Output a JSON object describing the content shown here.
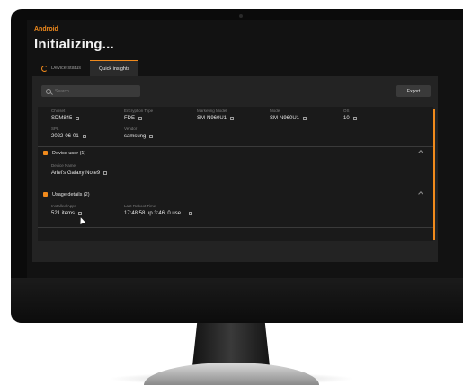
{
  "app": {
    "platform": "Android",
    "title": "Initializing..."
  },
  "tabs": [
    {
      "label": "Device status",
      "active": false
    },
    {
      "label": "Quick insights",
      "active": true
    }
  ],
  "toolbar": {
    "search_placeholder": "Search",
    "export_label": "Export"
  },
  "overview": {
    "fields": [
      {
        "label": "Chipset",
        "value": "SDM845"
      },
      {
        "label": "Encryption Type",
        "value": "FDE"
      },
      {
        "label": "Marketing Model",
        "value": "SM-N960U1"
      },
      {
        "label": "Model",
        "value": "SM-N960U1"
      },
      {
        "label": "OS",
        "value": "10"
      },
      {
        "label": "SPL",
        "value": "2022-06-01"
      },
      {
        "label": "Vendor",
        "value": "samsung"
      }
    ]
  },
  "sections": {
    "device_user": {
      "title": "Device user (1)",
      "fields": [
        {
          "label": "Device Name",
          "value": "Ariel's Galaxy Note9"
        }
      ]
    },
    "usage_details": {
      "title": "Usage details (2)",
      "fields": [
        {
          "label": "Installed Apps",
          "value": "521 items"
        },
        {
          "label": "Last Reboot Time",
          "value": "17:48:58 up 3:46, 0 use..."
        }
      ]
    }
  },
  "colors": {
    "accent": "#f08a1c",
    "background": "#121212",
    "panel": "#232323"
  }
}
